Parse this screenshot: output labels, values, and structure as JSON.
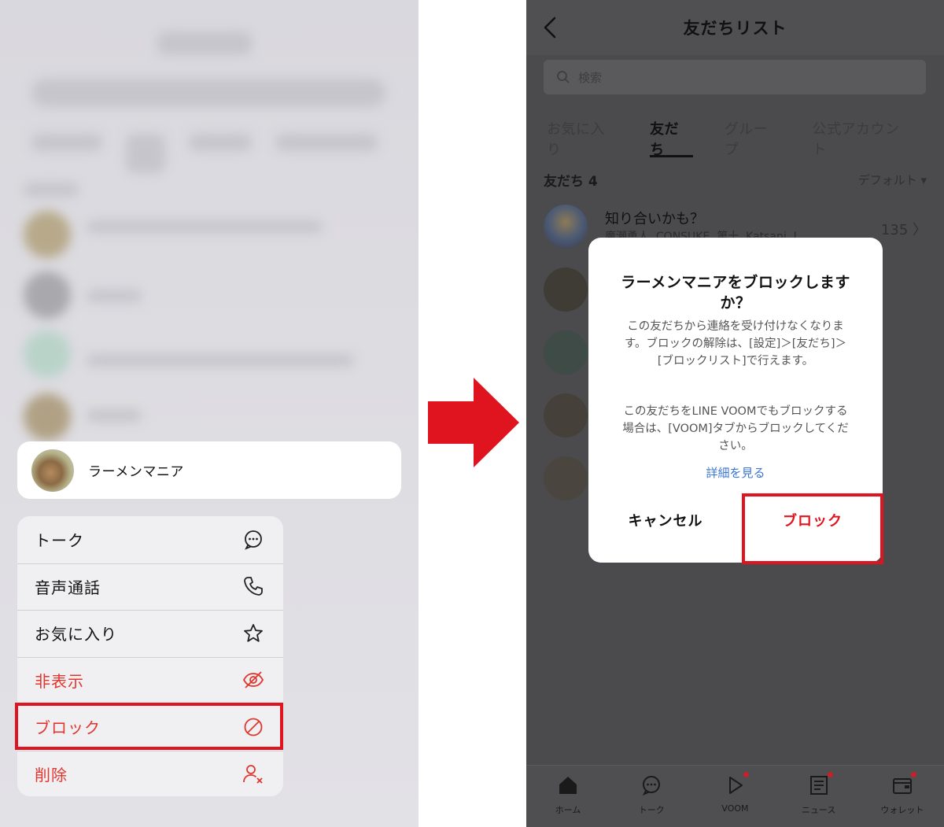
{
  "left": {
    "contact": {
      "name": "ラーメンマニア"
    },
    "menu": [
      {
        "label": "トーク",
        "icon": "chat-bubble-icon",
        "danger": false
      },
      {
        "label": "音声通話",
        "icon": "phone-icon",
        "danger": false
      },
      {
        "label": "お気に入り",
        "icon": "star-icon",
        "danger": false
      },
      {
        "label": "非表示",
        "icon": "eye-slash-icon",
        "danger": true
      },
      {
        "label": "ブロック",
        "icon": "block-icon",
        "danger": true
      },
      {
        "label": "削除",
        "icon": "person-remove-icon",
        "danger": true
      }
    ]
  },
  "arrow": {
    "color": "#e0141e",
    "icon": "right-arrow-icon"
  },
  "right": {
    "header": {
      "title": "友だちリスト"
    },
    "search": {
      "placeholder": "検索"
    },
    "tabs": [
      {
        "label": "お気に入り",
        "active": false
      },
      {
        "label": "友だち",
        "active": true
      },
      {
        "label": "グループ",
        "active": false
      },
      {
        "label": "公式アカウント",
        "active": false
      }
    ],
    "friends_count": "友だち 4",
    "sort": "デフォルト ▾",
    "suggestion": {
      "title": "知り合いかも？",
      "names": "廣瀬勇人, CONSUKE, 第十, Katsani, I",
      "count": "135 〉"
    },
    "dialog": {
      "title": "ラーメンマニアをブロックしますか？",
      "body1": "この友だちから連絡を受け付けなくなります。ブロックの解除は、[設定]＞[友だち]＞[ブロックリスト]で行えます。",
      "body2": "この友だちをLINE VOOMでもブロックする場合は、[VOOM]タブからブロックしてください。",
      "link": "詳細を見る",
      "cancel": "キャンセル",
      "block": "ブロック"
    },
    "tabbar": [
      {
        "label": "ホーム",
        "icon": "home-icon",
        "badge": false
      },
      {
        "label": "トーク",
        "icon": "chat-icon",
        "badge": false
      },
      {
        "label": "VOOM",
        "icon": "voom-icon",
        "badge": true
      },
      {
        "label": "ニュース",
        "icon": "news-icon",
        "badge": true
      },
      {
        "label": "ウォレット",
        "icon": "wallet-icon",
        "badge": true
      }
    ]
  },
  "colors": {
    "danger": "#e0362e",
    "highlight": "#e0141e",
    "link": "#3a76d6"
  }
}
